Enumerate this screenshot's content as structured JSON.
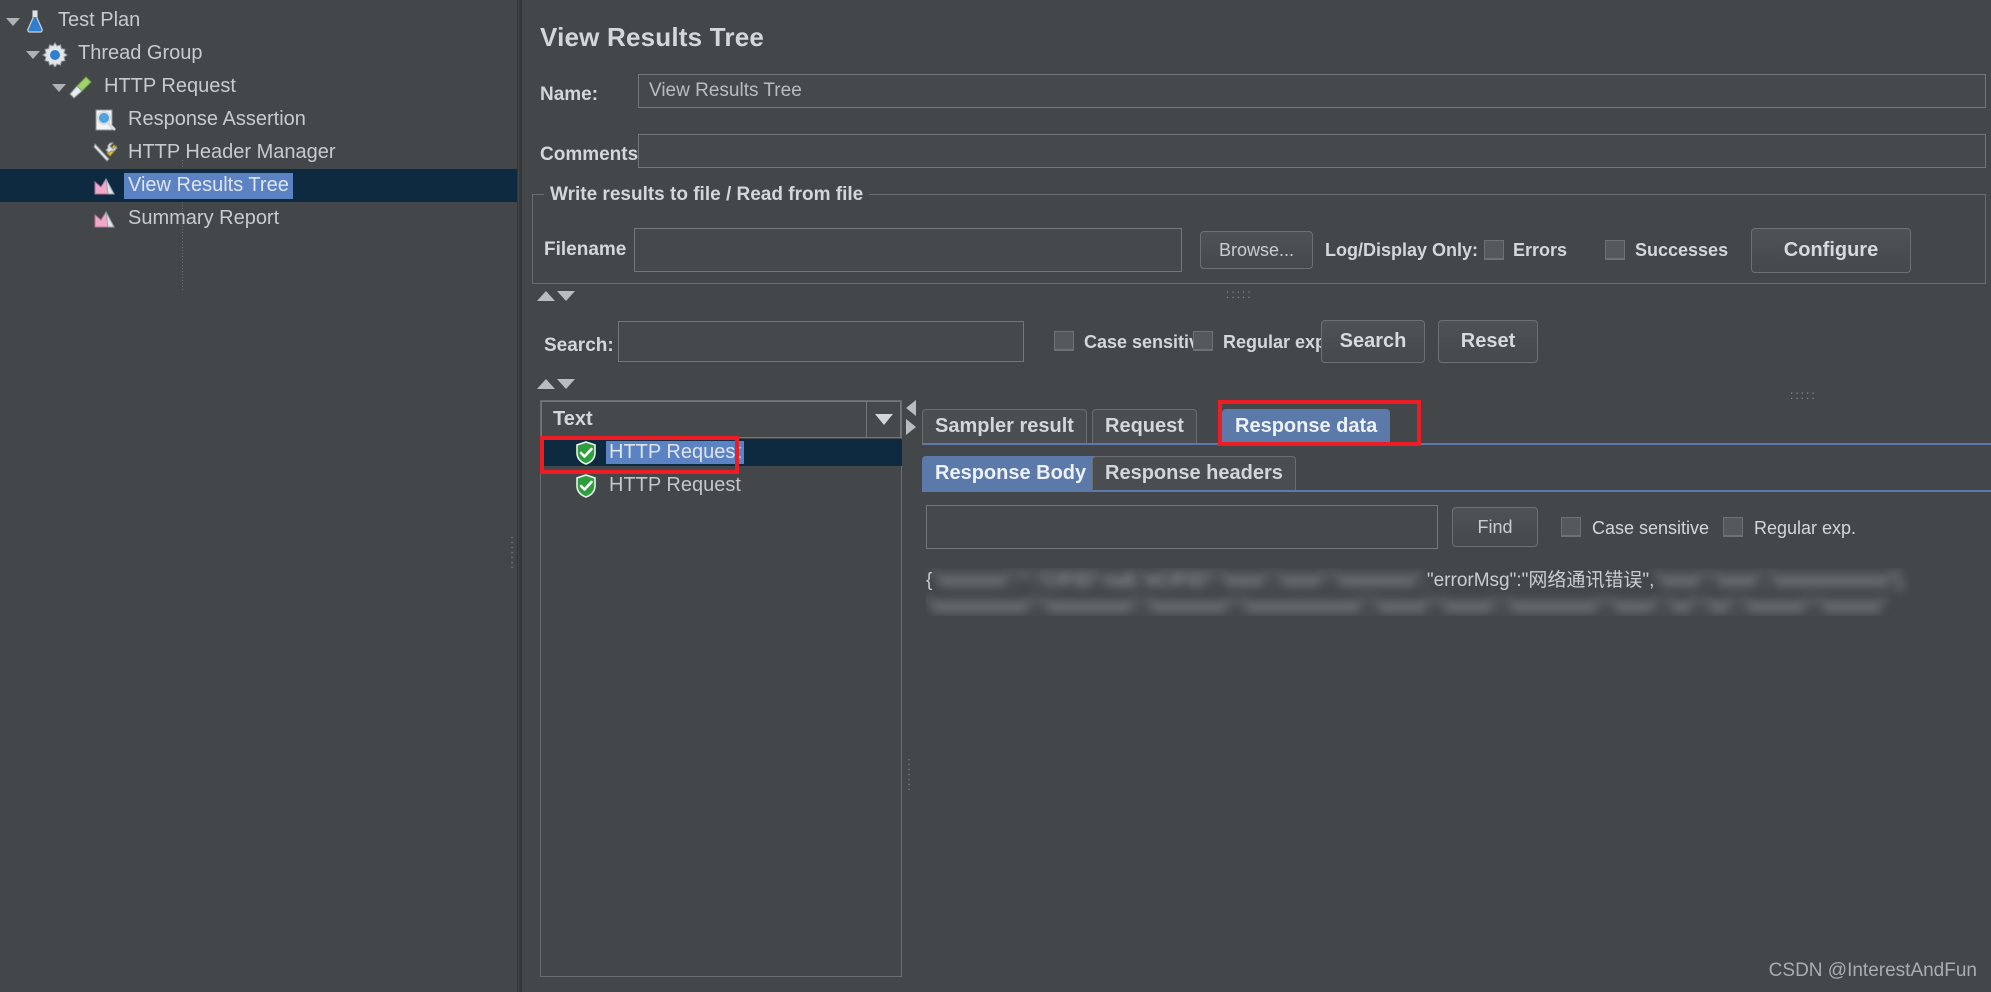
{
  "tree": {
    "items": [
      {
        "label": "Test Plan",
        "icon": "flask-icon",
        "depth": 0,
        "expanded": true,
        "selected": false
      },
      {
        "label": "Thread Group",
        "icon": "gear-icon",
        "depth": 1,
        "expanded": true,
        "selected": false
      },
      {
        "label": "HTTP Request",
        "icon": "pipette-icon",
        "depth": 2,
        "expanded": true,
        "selected": false
      },
      {
        "label": "Response Assertion",
        "icon": "magnifier-page-icon",
        "depth": 3,
        "expanded": false,
        "selected": false
      },
      {
        "label": "HTTP Header Manager",
        "icon": "tools-icon",
        "depth": 3,
        "expanded": false,
        "selected": false
      },
      {
        "label": "View Results Tree",
        "icon": "chart-icon",
        "depth": 3,
        "expanded": false,
        "selected": true
      },
      {
        "label": "Summary Report",
        "icon": "chart-icon",
        "depth": 3,
        "expanded": false,
        "selected": false
      }
    ]
  },
  "panel": {
    "title": "View Results Tree",
    "name_label": "Name:",
    "name_value": "View Results Tree",
    "comments_label": "Comments:",
    "comments_value": ""
  },
  "write_results": {
    "group_title": "Write results to file / Read from file",
    "filename_label": "Filename",
    "filename_value": "",
    "browse_button": "Browse...",
    "log_display_label": "Log/Display Only:",
    "errors_label": "Errors",
    "errors_checked": false,
    "successes_label": "Successes",
    "successes_checked": false,
    "configure_button": "Configure"
  },
  "search_bar": {
    "label": "Search:",
    "value": "",
    "case_sensitive_label": "Case sensitive",
    "case_sensitive_checked": false,
    "regular_exp_label": "Regular exp.",
    "regular_exp_checked": false,
    "search_button": "Search",
    "reset_button": "Reset"
  },
  "results": {
    "render_selector": "Text",
    "rows": [
      {
        "label": "HTTP Request",
        "status": "success",
        "selected": true
      },
      {
        "label": "HTTP Request",
        "status": "success",
        "selected": false
      }
    ]
  },
  "result_tabs": {
    "items": [
      {
        "label": "Sampler result",
        "active": false
      },
      {
        "label": "Request",
        "active": false
      },
      {
        "label": "Response data",
        "active": true
      }
    ]
  },
  "response_tabs": {
    "items": [
      {
        "label": "Response Body",
        "active": true
      },
      {
        "label": "Response headers",
        "active": false
      }
    ]
  },
  "find_bar": {
    "value": "",
    "find_button": "Find",
    "case_sensitive_label": "Case sensitive",
    "case_sensitive_checked": false,
    "regular_exp_label": "Regular exp.",
    "regular_exp_checked": false
  },
  "response_body": {
    "line1_prefix": "{",
    "line1_blur_a": "\"xxxxxxx\":\"\",\"CIFID\":null,\"eCIFID\":\"xxxx\",\"xxxx\":\"xxxxxxxx\",",
    "line1_visible": "\"errorMsg\":\"网络通讯错误\",",
    "line1_blur_b": "\"xxxx\":\"xxxx\",\"xxxxxxxxxxxx\"],",
    "line2_blur": "\"xxxxxxxxxx\":\"xxxxxxxxx\",\"xxxxxxxx\":\"xxxxxxxxxxxx\",\"xxxxx\":\"xxxxx\",\"xxxxxxxxx\":\"xxxx\",\"xx\":\"xx\",\"xxxxxx\":\"xxxxxx\""
  },
  "annotations": {
    "box1_target": "selected-result-row",
    "box2_target": "response-data-tab"
  },
  "watermark": "CSDN @InterestAndFun",
  "colors": {
    "background": "#43474a",
    "selection_navy": "#0e2a41",
    "selection_blue": "#5b83c4",
    "tab_active_blue": "#5b7aaa",
    "annotation_red": "#ee1c24",
    "text": "#c3c7ca"
  }
}
